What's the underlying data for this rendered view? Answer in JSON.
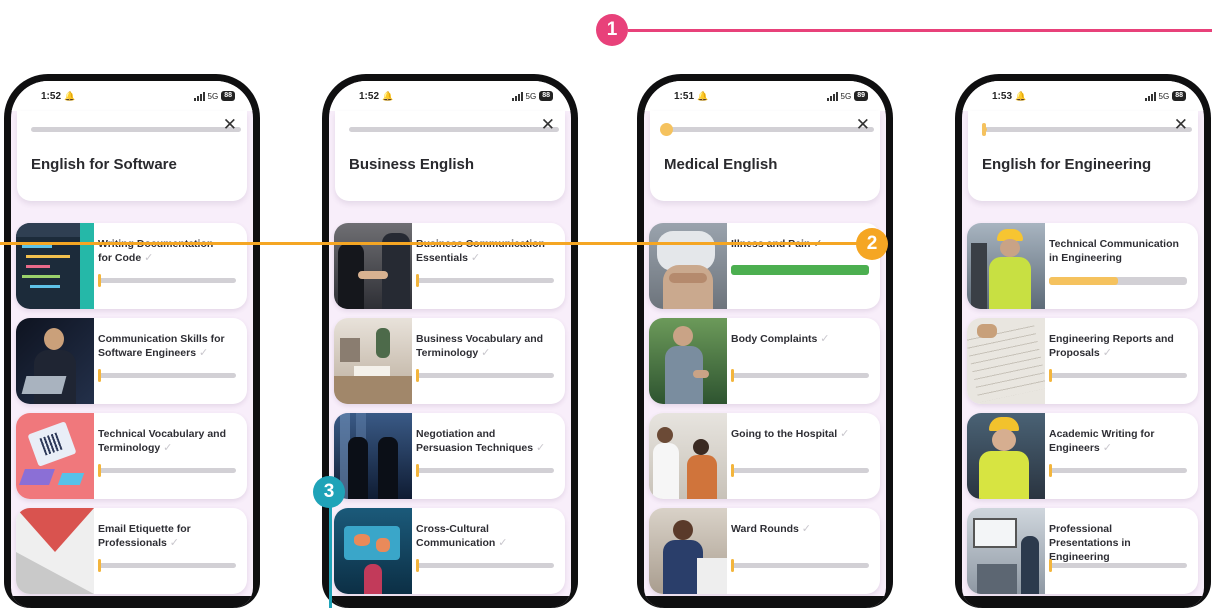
{
  "colors": {
    "callout_pink": "#e8417a",
    "callout_orange": "#f5a623",
    "callout_teal": "#1fa3b8",
    "progress_track": "#d2d0d5",
    "progress_yellow": "#f5c25e",
    "progress_green": "#4caf50",
    "screen_bg": "#f8eefa"
  },
  "callouts": [
    "1",
    "2",
    "3"
  ],
  "phones": [
    {
      "status": {
        "time": "1:52",
        "network": "5G",
        "battery": "88"
      },
      "top_progress": 0.0,
      "title": "English for Software",
      "lessons": [
        {
          "title": "Writing Documentation for Code",
          "progress": 0.0,
          "image": "code-editor-image"
        },
        {
          "title": "Communication Skills for Software Engineers",
          "progress": 0.0,
          "image": "engineer-laptop-image"
        },
        {
          "title": "Technical Vocabulary and Terminology",
          "progress": 0.0,
          "image": "isometric-tech-image"
        },
        {
          "title": "Email Etiquette for Professionals",
          "progress": 0.0,
          "image": "envelope-image"
        }
      ]
    },
    {
      "status": {
        "time": "1:52",
        "network": "5G",
        "battery": "88"
      },
      "top_progress": 0.0,
      "title": "Business English",
      "lessons": [
        {
          "title": "Business Communication Essentials",
          "progress": 0.0,
          "image": "handshake-image"
        },
        {
          "title": "Business Vocabulary and Terminology",
          "progress": 0.0,
          "image": "office-desk-image"
        },
        {
          "title": "Negotiation and Persuasion Techniques",
          "progress": 0.0,
          "image": "negotiation-image"
        },
        {
          "title": "Cross-Cultural Communication",
          "progress": 0.0,
          "image": "world-map-image"
        }
      ]
    },
    {
      "status": {
        "time": "1:51",
        "network": "5G",
        "battery": "89"
      },
      "top_progress": 0.03,
      "title": "Medical English",
      "lessons": [
        {
          "title": "Illness and Pain",
          "progress": 1.0,
          "image": "stomach-pain-image",
          "complete": true
        },
        {
          "title": "Body Complaints",
          "progress": 0.0,
          "image": "back-pain-image"
        },
        {
          "title": "Going to the Hospital",
          "progress": 0.0,
          "image": "doctor-visit-image"
        },
        {
          "title": "Ward Rounds",
          "progress": 0.0,
          "image": "nurse-image"
        }
      ]
    },
    {
      "status": {
        "time": "1:53",
        "network": "5G",
        "battery": "88"
      },
      "top_progress": 0.02,
      "title": "English for Engineering",
      "lessons": [
        {
          "title": "Technical Communication in Engineering",
          "progress": 0.5,
          "image": "hardhat-worker-image"
        },
        {
          "title": "Engineering Reports and Proposals",
          "progress": 0.0,
          "image": "blueprint-image"
        },
        {
          "title": "Academic Writing for Engineers",
          "progress": 0.0,
          "image": "site-engineer-image"
        },
        {
          "title": "Professional Presentations in Engineering",
          "progress": 0.0,
          "image": "presentation-image"
        }
      ]
    }
  ]
}
